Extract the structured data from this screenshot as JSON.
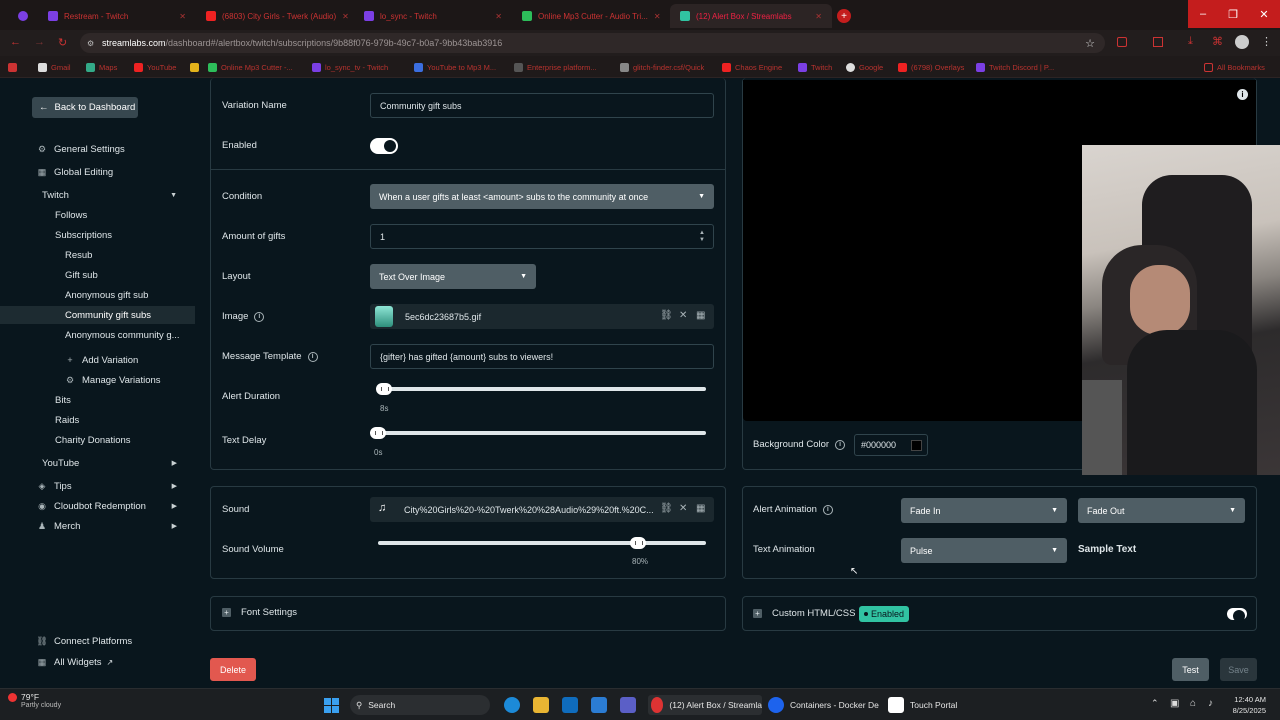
{
  "browser": {
    "tabs": [
      {
        "label": "Restream - Twitch",
        "color": "#7b3fe4"
      },
      {
        "label": "(6803) City Girls - Twerk (Audio)",
        "color": "#e22"
      },
      {
        "label": "lo_sync - Twitch",
        "color": "#7b3fe4"
      },
      {
        "label": "Online Mp3 Cutter - Audio Tri...",
        "color": "#2dbd5a"
      },
      {
        "label": "(12) Alert Box / Streamlabs",
        "color": "#31c3a2"
      }
    ],
    "url_host": "streamlabs.com",
    "url_path": "/dashboard#/alertbox/twitch/subscriptions/9b88f076-979b-49c7-b0a7-9bb43bab3916",
    "bookmarks": [
      "Gmail",
      "Maps",
      "YouTube",
      "Online Mp3 Cutter -...",
      "lo_sync_tv - Twitch",
      "YouTube to Mp3 M...",
      "Enterprise platform...",
      "glitch-finder.csf/Quick",
      "Chaos Engine",
      "Twitch",
      "Google",
      "(6798) Overlays",
      "Twitch Discord | P...",
      "All Bookmarks"
    ]
  },
  "sidebar": {
    "back_label": "Back to Dashboard",
    "items": [
      {
        "label": "General Settings",
        "icon": "gear-icon"
      },
      {
        "label": "Global Editing",
        "icon": "grid-icon"
      },
      {
        "label": "Twitch"
      },
      {
        "label": "Follows"
      },
      {
        "label": "Subscriptions"
      },
      {
        "label": "Resub"
      },
      {
        "label": "Gift sub"
      },
      {
        "label": "Anonymous gift sub"
      },
      {
        "label": "Community gift subs"
      },
      {
        "label": "Anonymous community g..."
      },
      {
        "label": "Add Variation"
      },
      {
        "label": "Manage Variations"
      },
      {
        "label": "Bits"
      },
      {
        "label": "Raids"
      },
      {
        "label": "Charity Donations"
      },
      {
        "label": "YouTube"
      },
      {
        "label": "Tips"
      },
      {
        "label": "Cloudbot Redemption"
      },
      {
        "label": "Merch"
      }
    ],
    "connect_platforms": "Connect Platforms",
    "all_widgets": "All Widgets"
  },
  "form": {
    "variation_name_label": "Variation Name",
    "variation_name_value": "Community gift subs",
    "enabled_label": "Enabled",
    "enabled": true,
    "condition_label": "Condition",
    "condition_value": "When a user gifts at least <amount> subs to the community at once",
    "amount_label": "Amount of gifts",
    "amount_value": "1",
    "layout_label": "Layout",
    "layout_value": "Text Over Image",
    "image_label": "Image",
    "image_value": "5ec6dc23687b5.gif",
    "message_template_label": "Message Template",
    "message_template_value": "{gifter} has gifted {amount} subs to viewers!",
    "alert_duration_label": "Alert Duration",
    "alert_duration_value": "8s",
    "alert_duration_fraction": 0.0,
    "text_delay_label": "Text Delay",
    "text_delay_value": "0s",
    "text_delay_fraction": 0.0,
    "sound_label": "Sound",
    "sound_value": "City%20Girls%20-%20Twerk%20%28Audio%29%20ft.%20C...",
    "sound_volume_label": "Sound Volume",
    "sound_volume_value": "80%",
    "sound_volume_fraction": 0.8,
    "font_settings_label": "Font Settings"
  },
  "right": {
    "background_color_label": "Background Color",
    "background_color_value": "#000000",
    "alert_animation_label": "Alert Animation",
    "alert_animation_in": "Fade In",
    "alert_animation_out": "Fade Out",
    "text_animation_label": "Text Animation",
    "text_animation_value": "Pulse",
    "sample_text": "Sample Text",
    "custom_html_label": "Custom HTML/CSS",
    "custom_html_badge": "Enabled"
  },
  "footer": {
    "delete_label": "Delete",
    "test_label": "Test",
    "save_label": "Save"
  },
  "taskbar": {
    "weather_temp": "79°F",
    "weather_desc": "Partly cloudy",
    "search_label": "Search",
    "apps": [
      "(12) Alert Box / Streamla",
      "Containers - Docker De",
      "Touch Portal"
    ],
    "time": "12:40 AM",
    "date": "8/25/2025"
  },
  "colors": {
    "accent": "#31c3a2",
    "delete": "#e2584f",
    "panel_border": "#283a42"
  }
}
